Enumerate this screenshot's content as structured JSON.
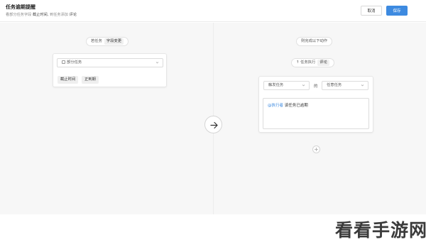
{
  "header": {
    "title": "任务逾期提醒",
    "subtitle_prefix": "看部分任务字段",
    "subtitle_field": "截止时间,",
    "subtitle_suffix": "到任务添加",
    "subtitle_end": "评论",
    "cancel_label": "取消",
    "save_label": "保存"
  },
  "trigger": {
    "when_label": "若任务",
    "when_tag": "字段变更",
    "select_value": "部分任务",
    "chips": [
      "截止时间",
      "正到期"
    ]
  },
  "action": {
    "header_label": "则完成以下动作",
    "exec_label": "任务执行",
    "exec_tag": "评论",
    "select1": "触发任务",
    "de_label": "的",
    "select2": "任意任务",
    "message_var": "@执行者",
    "message_text": "该任务已逾期"
  },
  "watermark": "看看手游网",
  "colors": {
    "accent": "#3d8ae0",
    "canvas": "#f7f7f7"
  }
}
